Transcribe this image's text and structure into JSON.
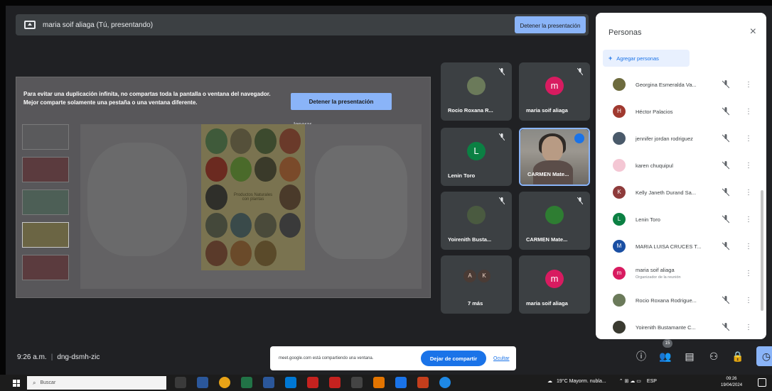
{
  "presenting_bar": {
    "label": "maria soif aliaga (Tú, presentando)",
    "stop_button": "Detener la presentación"
  },
  "shared_screen": {
    "warning": "Para evitar una duplicación infinita, no compartas toda la pantalla o ventana del navegador. Mejor comparte solamente una pestaña o una ventana diferente.",
    "stop_button": "Detener la presentación",
    "ignore": "Ignorar",
    "slide_caption": "Productos Naturales con plantas"
  },
  "tiles": [
    {
      "name": "Rocio Roxana R...",
      "avatar": "",
      "color": "#6b7a5a"
    },
    {
      "name": "maria soif aliaga",
      "avatar": "m",
      "color": "#d81b60"
    },
    {
      "name": "Lenin Toro",
      "avatar": "L",
      "color": "#0b8043"
    },
    {
      "name": "CARMEN Mate...",
      "avatar": "",
      "color": "#8a8a86"
    },
    {
      "name": "Yoirenith Busta...",
      "avatar": "",
      "color": "#4a5a40"
    },
    {
      "name": "CARMEN Mate...",
      "avatar": "",
      "color": "#2e7d32"
    },
    {
      "name": "7 más",
      "avatar": "",
      "color": "#4a3b35",
      "ak": [
        "A",
        "K"
      ]
    },
    {
      "name": "maria soif aliaga",
      "avatar": "m",
      "color": "#d81b60"
    }
  ],
  "people_panel": {
    "title": "Personas",
    "close": "×",
    "add_people": "Agregar personas",
    "people": [
      {
        "name": "Georgina Esmeralda Va...",
        "initial": "",
        "color": "#6d6b3e"
      },
      {
        "name": "Héctor Palacios",
        "initial": "H",
        "color": "#a0392f"
      },
      {
        "name": "jennifer jordan rodriguez",
        "initial": "",
        "color": "#4a5a6a"
      },
      {
        "name": "karen chuquipul",
        "initial": "",
        "color": "#f4c7d4"
      },
      {
        "name": "Kelly Janeth Durand Sa...",
        "initial": "K",
        "color": "#8e3b3b"
      },
      {
        "name": "Lenin Toro",
        "initial": "L",
        "color": "#0b8043"
      },
      {
        "name": "MARIA LUISA CRUCES T...",
        "initial": "M",
        "color": "#1a4fa3"
      },
      {
        "name": "maria soif aliaga",
        "initial": "m",
        "color": "#d81b60",
        "sub": "Organizador de la reunión"
      },
      {
        "name": "Rocio Roxana Rodrigue...",
        "initial": "",
        "color": "#6b7a5a"
      },
      {
        "name": "Yoirenith Bustamante C...",
        "initial": "",
        "color": "#3a3a30"
      }
    ]
  },
  "bottom": {
    "time": "9:26 a.m.",
    "meeting_code": "dng-dsmh-zic",
    "share_text": "meet.google.com está compartiendo una ventana.",
    "share_stop": "Dejar de compartir",
    "share_hide": "Ocultar",
    "participants_count": "15"
  },
  "taskbar": {
    "search_placeholder": "Buscar",
    "weather": "19°C Mayorm. nubla...",
    "lang": "ESP",
    "clock_time": "09:26",
    "clock_date": "19/04/2024"
  }
}
